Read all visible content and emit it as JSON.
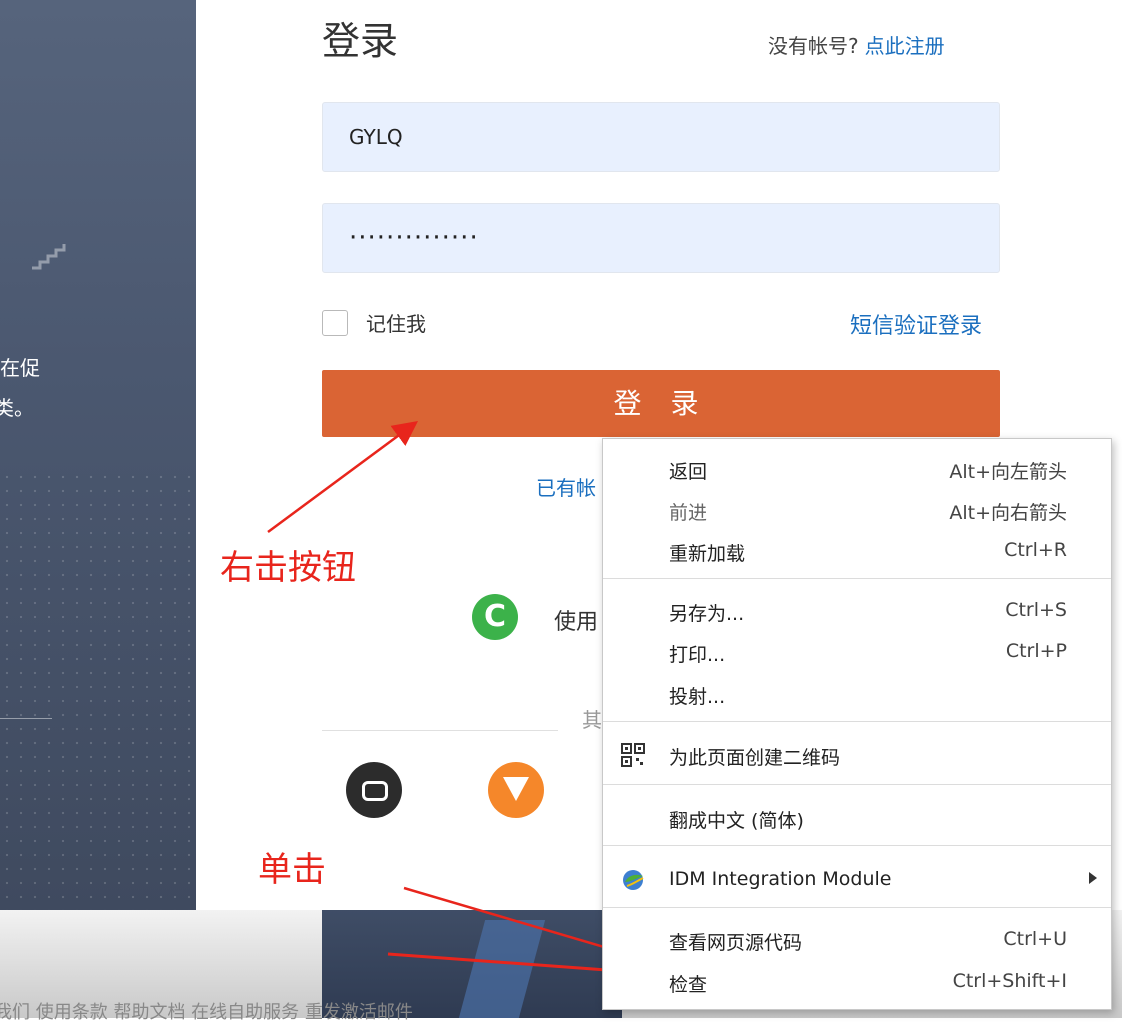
{
  "left_panel": {
    "text_line1": "在促",
    "text_line2": "类。"
  },
  "login": {
    "title": "登录",
    "no_account": "没有帐号?",
    "register_link": "点此注册",
    "username": "GYLQ",
    "password_mask": "··············",
    "remember_label": "记住我",
    "sms_login": "短信验证登录",
    "login_button": "登 录",
    "has_account_partial": "已有帐",
    "use_partial": "使用",
    "other_partial": "其"
  },
  "annotations": {
    "right_click": "右击按钮",
    "single_click": "单击"
  },
  "footer_links": "我们  使用条款  帮助文档  在线自助服务  重发激活邮件",
  "context_menu": {
    "items": [
      {
        "label": "返回",
        "shortcut": "Alt+向左箭头"
      },
      {
        "label": "前进",
        "shortcut": "Alt+向右箭头"
      },
      {
        "label": "重新加载",
        "shortcut": "Ctrl+R"
      },
      {
        "label": "另存为...",
        "shortcut": "Ctrl+S"
      },
      {
        "label": "打印...",
        "shortcut": "Ctrl+P"
      },
      {
        "label": "投射..."
      },
      {
        "label": "为此页面创建二维码",
        "icon": "qr-code-icon"
      },
      {
        "label": "翻成中文 (简体)"
      },
      {
        "label": "IDM Integration Module",
        "icon": "idm-icon"
      },
      {
        "label": "查看网页源代码",
        "shortcut": "Ctrl+U"
      },
      {
        "label": "检查",
        "shortcut": "Ctrl+Shift+I"
      }
    ]
  },
  "colors": {
    "accent": "#da6434",
    "link": "#1b6fbf",
    "annotation": "#e8251c",
    "input_bg": "#e8f0fe"
  }
}
